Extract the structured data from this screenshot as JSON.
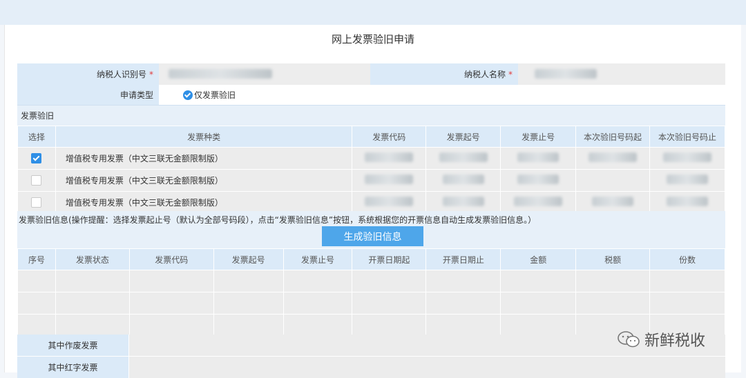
{
  "page": {
    "title": "网上发票验旧申请"
  },
  "form": {
    "taxpayer_id_label": "纳税人识别号",
    "taxpayer_name_label": "纳税人名称",
    "required_mark": "*",
    "application_type_label": "申请类型",
    "application_type_value": "仅发票验旧"
  },
  "section": {
    "title": "发票验旧"
  },
  "invoice_table": {
    "headers": [
      "选择",
      "发票种类",
      "发票代码",
      "发票起号",
      "发票止号",
      "本次验旧号码起",
      "本次验旧号码止"
    ],
    "rows": [
      {
        "checked": true,
        "type": "增值税专用发票（中文三联无金额限制版）"
      },
      {
        "checked": false,
        "type": "增值税专用发票（中文三联无金额限制版）"
      },
      {
        "checked": false,
        "type": "增值税专用发票（中文三联无金额限制版）"
      }
    ]
  },
  "info": {
    "text": "发票验旧信息(操作提醒：选择发票起止号（默认为全部号码段），点击“发票验旧信息”按钮，系统根据您的开票信息自动生成发票验旧信息。）",
    "button_label": "生成验旧信息"
  },
  "result_table": {
    "headers": [
      "序号",
      "发票状态",
      "发票代码",
      "发票起号",
      "发票止号",
      "开票日期起",
      "开票日期止",
      "金额",
      "税额",
      "份数"
    ]
  },
  "summary": {
    "void_label": "其中作废发票",
    "red_label": "其中红字发票"
  },
  "watermark": {
    "text": "新鲜税收"
  },
  "colors": {
    "accent": "#4ea6ea",
    "header_bg": "#dbeaf8",
    "cell_bg": "#ececec",
    "required": "#e03b3b"
  }
}
